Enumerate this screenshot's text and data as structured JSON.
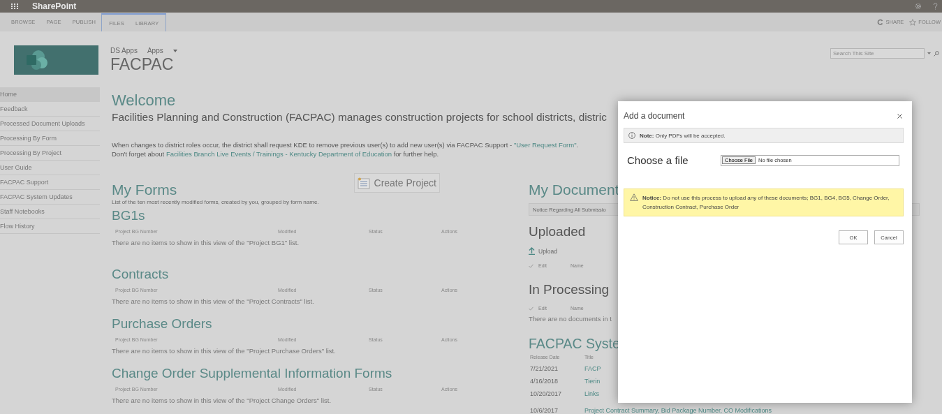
{
  "top_bar": {
    "brand": "SharePoint"
  },
  "ribbon": {
    "tabs": [
      {
        "label": "BROWSE"
      },
      {
        "label": "PAGE"
      },
      {
        "label": "PUBLISH"
      }
    ],
    "context_tabs": [
      {
        "label": "FILES"
      },
      {
        "label": "LIBRARY"
      }
    ],
    "actions": [
      {
        "label": "SHARE",
        "kind": "share"
      },
      {
        "label": "FOLLOW",
        "kind": "follow"
      }
    ]
  },
  "header": {
    "breadcrumb": [
      "DS Apps",
      "Apps"
    ],
    "site_title": "FACPAC",
    "search": {
      "placeholder": "Search This Site"
    }
  },
  "sidebar": {
    "items": [
      {
        "label": "Home",
        "selected": true
      },
      {
        "label": "Feedback",
        "selected": false
      },
      {
        "label": "Processed Document Uploads",
        "selected": false
      },
      {
        "label": "Processing By Form",
        "selected": false
      },
      {
        "label": "Processing By Project",
        "selected": false
      },
      {
        "label": "User Guide",
        "selected": false
      },
      {
        "label": "FACPAC Support",
        "selected": false
      },
      {
        "label": "FACPAC System Updates",
        "selected": false
      },
      {
        "label": "Staff Notebooks",
        "selected": false
      },
      {
        "label": "Flow History",
        "selected": false
      }
    ]
  },
  "welcome": {
    "title": "Welcome",
    "description": "Facilities Planning and Construction (FACPAC) manages construction projects for school districts, distric",
    "notes": [
      [
        {
          "text": "When changes to district roles occur, the district shall request KDE to remove previous user(s) to add new user(s) via FACPAC Support - ",
          "link": false
        },
        {
          "text": "\"User Request Form\"",
          "link": true
        },
        {
          "text": ".",
          "link": false
        }
      ],
      [
        {
          "text": "Don't forget about ",
          "link": false
        },
        {
          "text": "Facilities Branch Live Events / Trainings - Kentucky Department of Education",
          "link": true
        },
        {
          "text": " for further help.",
          "link": false
        }
      ]
    ]
  },
  "my_forms": {
    "title": "My Forms",
    "create_button": "Create Project",
    "subtitle": "List of the ten most recently modified forms, created by you, grouped by form name.",
    "lists": [
      {
        "title": "BG1s",
        "columns": [
          "Project BG Number",
          "Modified",
          "Status",
          "Actions"
        ],
        "empty_text": "There are no items to show in this view of the \"Project BG1\" list."
      },
      {
        "title": "Contracts",
        "columns": [
          "Project BG Number",
          "Modified",
          "Status",
          "Actions"
        ],
        "empty_text": "There are no items to show in this view of the \"Project Contracts\" list."
      },
      {
        "title": "Purchase Orders",
        "columns": [
          "Project BG Number",
          "Modified",
          "Status",
          "Actions"
        ],
        "empty_text": "There are no items to show in this view of the \"Project Purchase Orders\" list."
      },
      {
        "title": "Change Order Supplemental Information Forms",
        "columns": [
          "Project BG Number",
          "Modified",
          "Status",
          "Actions"
        ],
        "empty_text": "There are no items to show in this view of the \"Project Change Orders\" list."
      }
    ]
  },
  "my_documents": {
    "title": "My Document",
    "notice": "Notice Regarding All Submissio",
    "uploaded": {
      "title": "Uploaded",
      "upload_button": "Upload",
      "columns": [
        "Edit",
        "Name"
      ]
    },
    "in_processing": {
      "title": "In Processing",
      "columns": [
        "Edit",
        "Name"
      ],
      "empty_text": "There are no documents in t"
    },
    "system_updates": {
      "title": "FACPAC Syste",
      "columns": [
        "Release Date",
        "Title"
      ],
      "rows": [
        {
          "date": "7/21/2021",
          "title": "FACP"
        },
        {
          "date": "4/16/2018",
          "title": "Tierin"
        },
        {
          "date": "10/20/2017",
          "title": "Links"
        },
        {
          "date": "10/6/2017",
          "title": "Project Contract Summary, Bid Package Number, CO Modifications"
        }
      ]
    }
  },
  "dialog": {
    "title": "Add a document",
    "note": "**Note:** Only PDFs will be accepted.",
    "file_label": "Choose a file",
    "file_button": "Choose File",
    "file_status": "No file chosen",
    "notice": "**Notice:** Do not use this process to upload any of these documents; BG1, BG4, BG5, Change Order, Construction Contract, Purchase Order",
    "buttons": [
      {
        "label": "OK"
      },
      {
        "label": "Cancel"
      }
    ]
  }
}
